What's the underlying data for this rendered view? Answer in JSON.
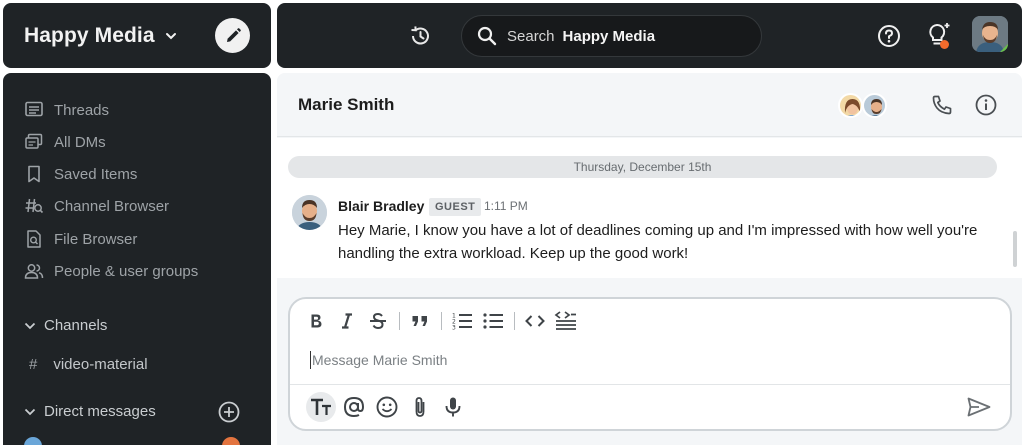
{
  "workspace": {
    "name": "Happy Media"
  },
  "topbar": {
    "search_placeholder": "Search",
    "search_scope": "Happy Media"
  },
  "sidebar": {
    "items": [
      {
        "label": "Threads",
        "icon": "threads-icon"
      },
      {
        "label": "All DMs",
        "icon": "all-dms-icon"
      },
      {
        "label": "Saved Items",
        "icon": "bookmark-icon"
      },
      {
        "label": "Channel Browser",
        "icon": "channel-browser-icon"
      },
      {
        "label": "File Browser",
        "icon": "file-browser-icon"
      },
      {
        "label": "People & user groups",
        "icon": "people-icon"
      }
    ],
    "channels_label": "Channels",
    "channels": [
      {
        "name": "video-material"
      }
    ],
    "dms_label": "Direct messages"
  },
  "chat": {
    "title": "Marie Smith",
    "date_divider": "Thursday, December 15th",
    "message": {
      "author": "Blair Bradley",
      "badge": "GUEST",
      "time": "1:11 PM",
      "text": "Hey Marie, I know you have a lot of deadlines coming up and I'm impressed with how well you're handling the extra workload. Keep up the good work!"
    },
    "composer": {
      "placeholder": "Message Marie Smith"
    }
  },
  "colors": {
    "sidebar_bg": "#1f2326",
    "main_bg": "#f4f6f8",
    "notification_dot": "#f26b2c",
    "online_status": "#6bc04b"
  }
}
